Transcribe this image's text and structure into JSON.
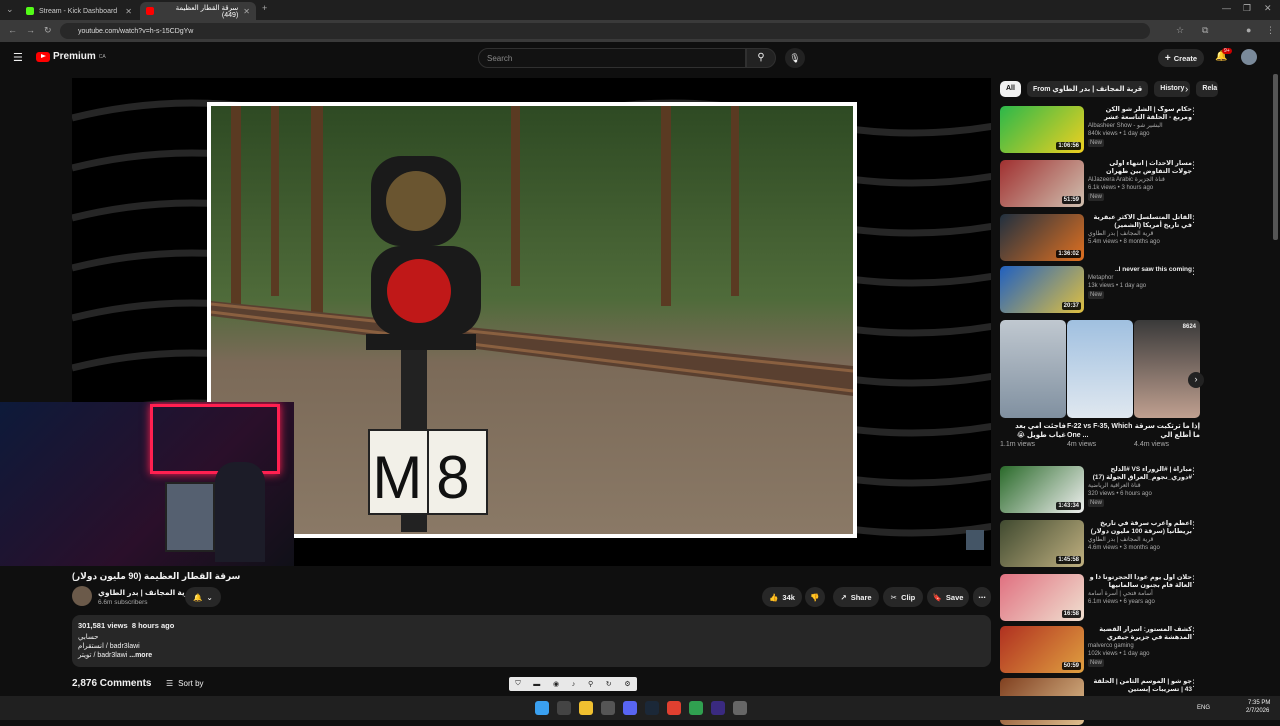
{
  "browser": {
    "tabs": [
      {
        "label": "Stream - Kick Dashboard",
        "fav": "#53fc18"
      },
      {
        "label": "سرقة القطار العظيمة (449)",
        "fav": "#ff0000"
      }
    ],
    "url": "youtube.com/watch?v=h-s-15CDgYw"
  },
  "header": {
    "brand": "Premium",
    "region": "CA",
    "search_placeholder": "Search",
    "create_label": "Create",
    "notif_count": "9+"
  },
  "video": {
    "title": "سرقة القطار العظيمة (90 مليون دولار)",
    "channel": "قرية المجانف | بدر الطاوي",
    "subs": "6.6m subscribers",
    "likes": "34k",
    "share": "Share",
    "clip": "Clip",
    "save": "Save",
    "sign_text": "M8",
    "views": "301,581 views",
    "age": "8 hours ago",
    "desc1": "حسابي",
    "desc2": "انستقرام / badr3lawi",
    "desc3": "تويتر / badr3lawi",
    "more": "...more"
  },
  "comments": {
    "count": "2,876 Comments",
    "sort": "Sort by"
  },
  "chips": [
    "All",
    "From قرية المجانف | بدر الطاوي",
    "History",
    "Rela"
  ],
  "recs": [
    {
      "title": "حكام سوگ | الشلر شو الكن ومربع - الحلقة التاسعة عشر كاملة",
      "channel": "Albasheer Show - البشير شو",
      "meta": "840k views • 1 day ago",
      "dur": "1:06:56",
      "new": "New",
      "c1": "#2bb84a",
      "c2": "#f0d020"
    },
    {
      "title": "مسار الأحداث | انتهاء أولى جولات التفاوض بين طهران وواشنطن دون نتائج ملموسة",
      "channel": "AlJazeera Arabic قناة الجزيرة",
      "meta": "6.1k views • 3 hours ago",
      "dur": "51:59",
      "new": "New",
      "c1": "#a03030",
      "c2": "#d0c0b0"
    },
    {
      "title": "القاتل المتسلسل الأكثر عبقرية في تاريخ أمريكا (الشمير)",
      "channel": "قرية المجانف | بدر الطاوي",
      "meta": "5.4m views • 8 months ago",
      "dur": "1:36:02",
      "new": "",
      "c1": "#203040",
      "c2": "#e07020"
    },
    {
      "title": "I never saw this coming..",
      "channel": "Metaphor",
      "meta": "13k views • 1 day ago",
      "dur": "20:37",
      "new": "New",
      "c1": "#2060c0",
      "c2": "#e0c040"
    },
    {
      "title": "مباراة | #الزوراء VS #الدلح #دوري_نجوم_العراق الجولة (17)",
      "channel": "قناة العراقية الرياضية",
      "meta": "320 views • 6 hours ago",
      "dur": "1:43:34",
      "new": "New",
      "c1": "#2a6a2a",
      "c2": "#f0f0f0"
    },
    {
      "title": "أعظم وأغرب سرقة في تاريخ بريطانيا (سرقة 100 مليون دولار)",
      "channel": "قرية المجانف | بدر الطاوي",
      "meta": "4.6m views • 3 months ago",
      "dur": "1:45:58",
      "new": "",
      "c1": "#404a30",
      "c2": "#c0b080"
    },
    {
      "title": "حلان أول يوم عودا الحجرتونا ذا و العالة فام بجنون سالمانيها",
      "channel": "أسامة فتحي | أسرة أسامة",
      "meta": "6.1m views • 6 years ago",
      "dur": "16:58",
      "new": "",
      "c1": "#e07080",
      "c2": "#f0e0d0"
    },
    {
      "title": "كشف المستور: أسرار القضية المدهشة في جزيرة جيفري ابستين !",
      "channel": "malverco gaming",
      "meta": "102k views • 1 day ago",
      "dur": "50:59",
      "new": "New",
      "c1": "#b03020",
      "c2": "#e0a040"
    },
    {
      "title": "جو شو | الموسم الثامن | الحلقة 43 | تسريبات إبستين",
      "channel": "",
      "meta": "",
      "dur": "",
      "new": "",
      "c1": "#804020",
      "c2": "#e0c090"
    }
  ],
  "shorts": [
    {
      "title": "فاجئت أمي بعد غياب طويل 😭",
      "views": "1.1m views",
      "c1": "#c0c8d0",
      "c2": "#8090a0"
    },
    {
      "title": "F-22 vs F-35, Which One ...",
      "views": "4m views",
      "c1": "#a0c0e0",
      "c2": "#e0e8f0"
    },
    {
      "title": "إذا ما ترتكبت سرقة ما أطلع الي",
      "views": "4.4m views",
      "c1": "#3a3a3a",
      "c2": "#c0a090",
      "badge": "8624"
    }
  ],
  "taskbar": {
    "lang": "ENG",
    "time": "7:35 PM",
    "date": "2/7/2026"
  }
}
